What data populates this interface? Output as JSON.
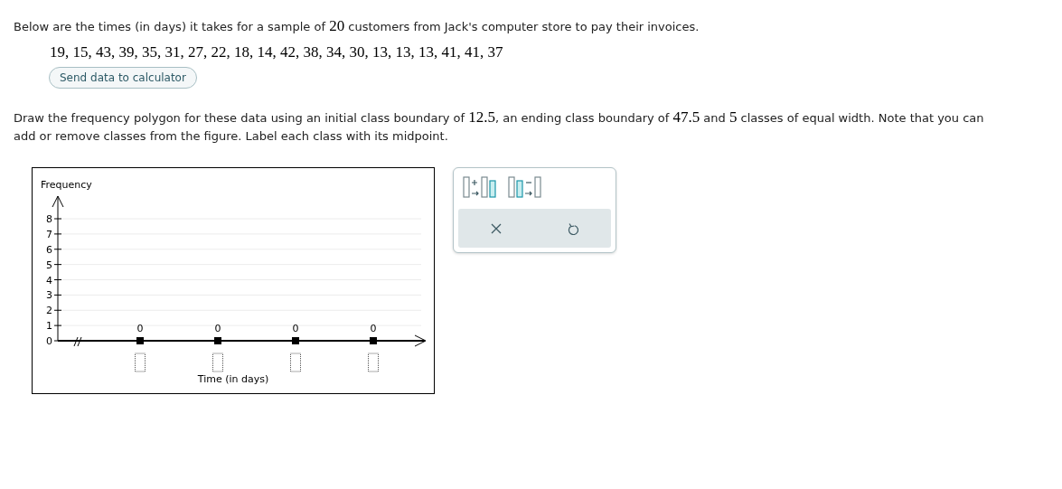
{
  "intro": [
    {
      "kind": "text",
      "text": "Below are the times (in days) it takes for a sample of "
    },
    {
      "kind": "math",
      "text": "20"
    },
    {
      "kind": "text",
      "text": " customers from Jack's computer store to pay their invoices."
    }
  ],
  "data_list": "19, 15, 43, 39, 35, 31, 27, 22, 18, 14, 42, 38, 34, 30, 13, 13, 13, 41, 41, 37",
  "send_button": "Send data to calculator",
  "instructions": [
    {
      "kind": "text",
      "text": "Draw the frequency polygon for these data using an initial class boundary of "
    },
    {
      "kind": "math",
      "text": "12.5"
    },
    {
      "kind": "text",
      "text": ", an ending class boundary of "
    },
    {
      "kind": "math",
      "text": "47.5"
    },
    {
      "kind": "text",
      "text": " and "
    },
    {
      "kind": "math",
      "text": "5"
    },
    {
      "kind": "text",
      "text": " classes of equal width. Note that you can add or remove classes from the figure. Label each class with its midpoint."
    }
  ],
  "graph": {
    "y_axis_title": "Frequency",
    "x_axis_title": "Time (in days)",
    "y_ticks": [
      "8",
      "7",
      "6",
      "5",
      "4",
      "3",
      "2",
      "1",
      "0"
    ],
    "classes": [
      {
        "frequency": "0"
      },
      {
        "frequency": "0"
      },
      {
        "frequency": "0"
      },
      {
        "frequency": "0"
      }
    ]
  },
  "tools": [
    {
      "kind": "add_class"
    },
    {
      "kind": "remove_class"
    }
  ],
  "actions": [
    {
      "kind": "clear"
    },
    {
      "kind": "undo"
    }
  ]
}
